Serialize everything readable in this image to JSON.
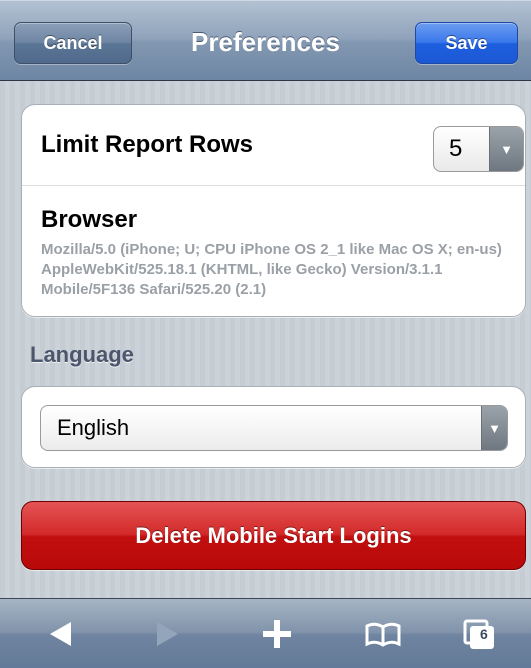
{
  "navbar": {
    "title": "Preferences",
    "cancel_label": "Cancel",
    "save_label": "Save"
  },
  "preferences": {
    "limit_label": "Limit Report Rows",
    "limit_value": "5",
    "browser_label": "Browser",
    "user_agent": "Mozilla/5.0 (iPhone; U; CPU iPhone OS 2_1 like Mac OS X; en-us) AppleWebKit/525.18.1 (KHTML, like Gecko) Version/3.1.1 Mobile/5F136 Safari/525.20 (2.1)"
  },
  "language": {
    "section_label": "Language",
    "value": "English"
  },
  "actions": {
    "delete_label": "Delete Mobile Start Logins"
  },
  "toolbar": {
    "tabs_count": "6",
    "icons": [
      "back-icon",
      "forward-icon",
      "plus-icon",
      "bookmarks-icon",
      "tabs-icon"
    ]
  },
  "colors": {
    "save_blue": "#1d5fe0",
    "delete_red": "#c20e0e",
    "nav_steel": "#6d86a4"
  }
}
